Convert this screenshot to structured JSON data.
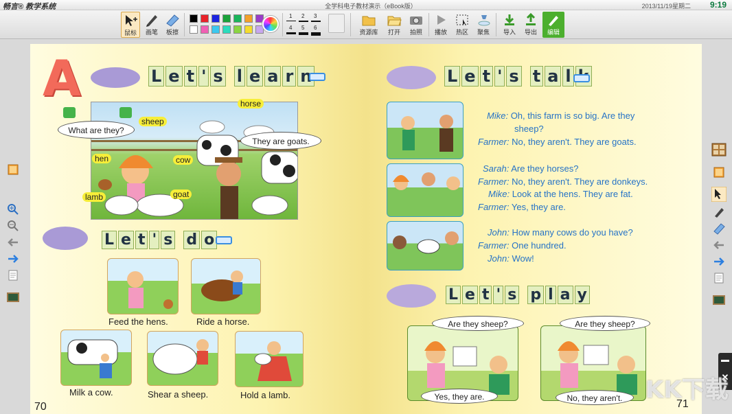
{
  "titlebar": {
    "brand": "畅言® 教学系统",
    "window_title": "全学科电子教材演示（eBook版）",
    "date": "2013/11/19星期二",
    "time": "9:19"
  },
  "toolbar": {
    "mouse": "鼠标",
    "pen": "画笔",
    "eraser": "板擦",
    "width_labels": [
      "1",
      "2",
      "3",
      "4",
      "5",
      "6"
    ],
    "resource": "资源库",
    "open": "打开",
    "photo": "拍照",
    "play": "播放",
    "hotzone": "热区",
    "focus": "聚焦",
    "import": "导入",
    "export": "导出",
    "edit": "编辑"
  },
  "colors": {
    "swatches_top": [
      "#000000",
      "#e8232a",
      "#1c24e0",
      "#1aa23a",
      "#1bb55b",
      "#f4a12a",
      "#9a3cc9"
    ],
    "swatches_bottom": [
      "#ffffff",
      "#f060b4",
      "#3cc8ef",
      "#2bdcbd",
      "#8bd542",
      "#f5dc2e",
      "#c8a7ef"
    ]
  },
  "left_page": {
    "lets_learn": [
      "L",
      "e",
      "t",
      "'",
      "s",
      "l",
      "e",
      "a",
      "r",
      "n"
    ],
    "scene_bubbles": {
      "question": "What are they?",
      "answer": "They are goats."
    },
    "animals": [
      "horse",
      "sheep",
      "hen",
      "cow",
      "lamb",
      "goat"
    ],
    "lets_do": [
      "L",
      "e",
      "t",
      "'",
      "s",
      "d",
      "o"
    ],
    "actions": [
      "Feed the hens.",
      "Ride a horse.",
      "Milk a cow.",
      "Shear a sheep.",
      "Hold a lamb."
    ],
    "page_number": "70"
  },
  "right_page": {
    "lets_talk": [
      "L",
      "e",
      "t",
      "'",
      "s",
      "t",
      "a",
      "l",
      "k"
    ],
    "dialogue": [
      {
        "speaker": "Mike:",
        "line": "Oh, this farm is so big. Are they"
      },
      {
        "speaker": "",
        "line": "sheep?"
      },
      {
        "speaker": "Farmer:",
        "line": "No, they aren't. They are goats."
      },
      {
        "speaker": "Sarah:",
        "line": "Are they horses?"
      },
      {
        "speaker": "Farmer:",
        "line": "No, they aren't. They are donkeys."
      },
      {
        "speaker": "Mike:",
        "line": "Look at the hens. They are fat."
      },
      {
        "speaker": "Farmer:",
        "line": "Yes, they are."
      },
      {
        "speaker": "John:",
        "line": "How many cows do you have?"
      },
      {
        "speaker": "Farmer:",
        "line": "One hundred."
      },
      {
        "speaker": "John:",
        "line": "Wow!"
      }
    ],
    "lets_play": [
      "L",
      "e",
      "t",
      "'",
      "s",
      "p",
      "l",
      "a",
      "y"
    ],
    "play_bubbles": {
      "q1": "Are they sheep?",
      "a1": "Yes, they are.",
      "q2": "Are they sheep?",
      "a2": "No, they aren't."
    },
    "page_number": "71"
  },
  "watermark": "KK下载"
}
